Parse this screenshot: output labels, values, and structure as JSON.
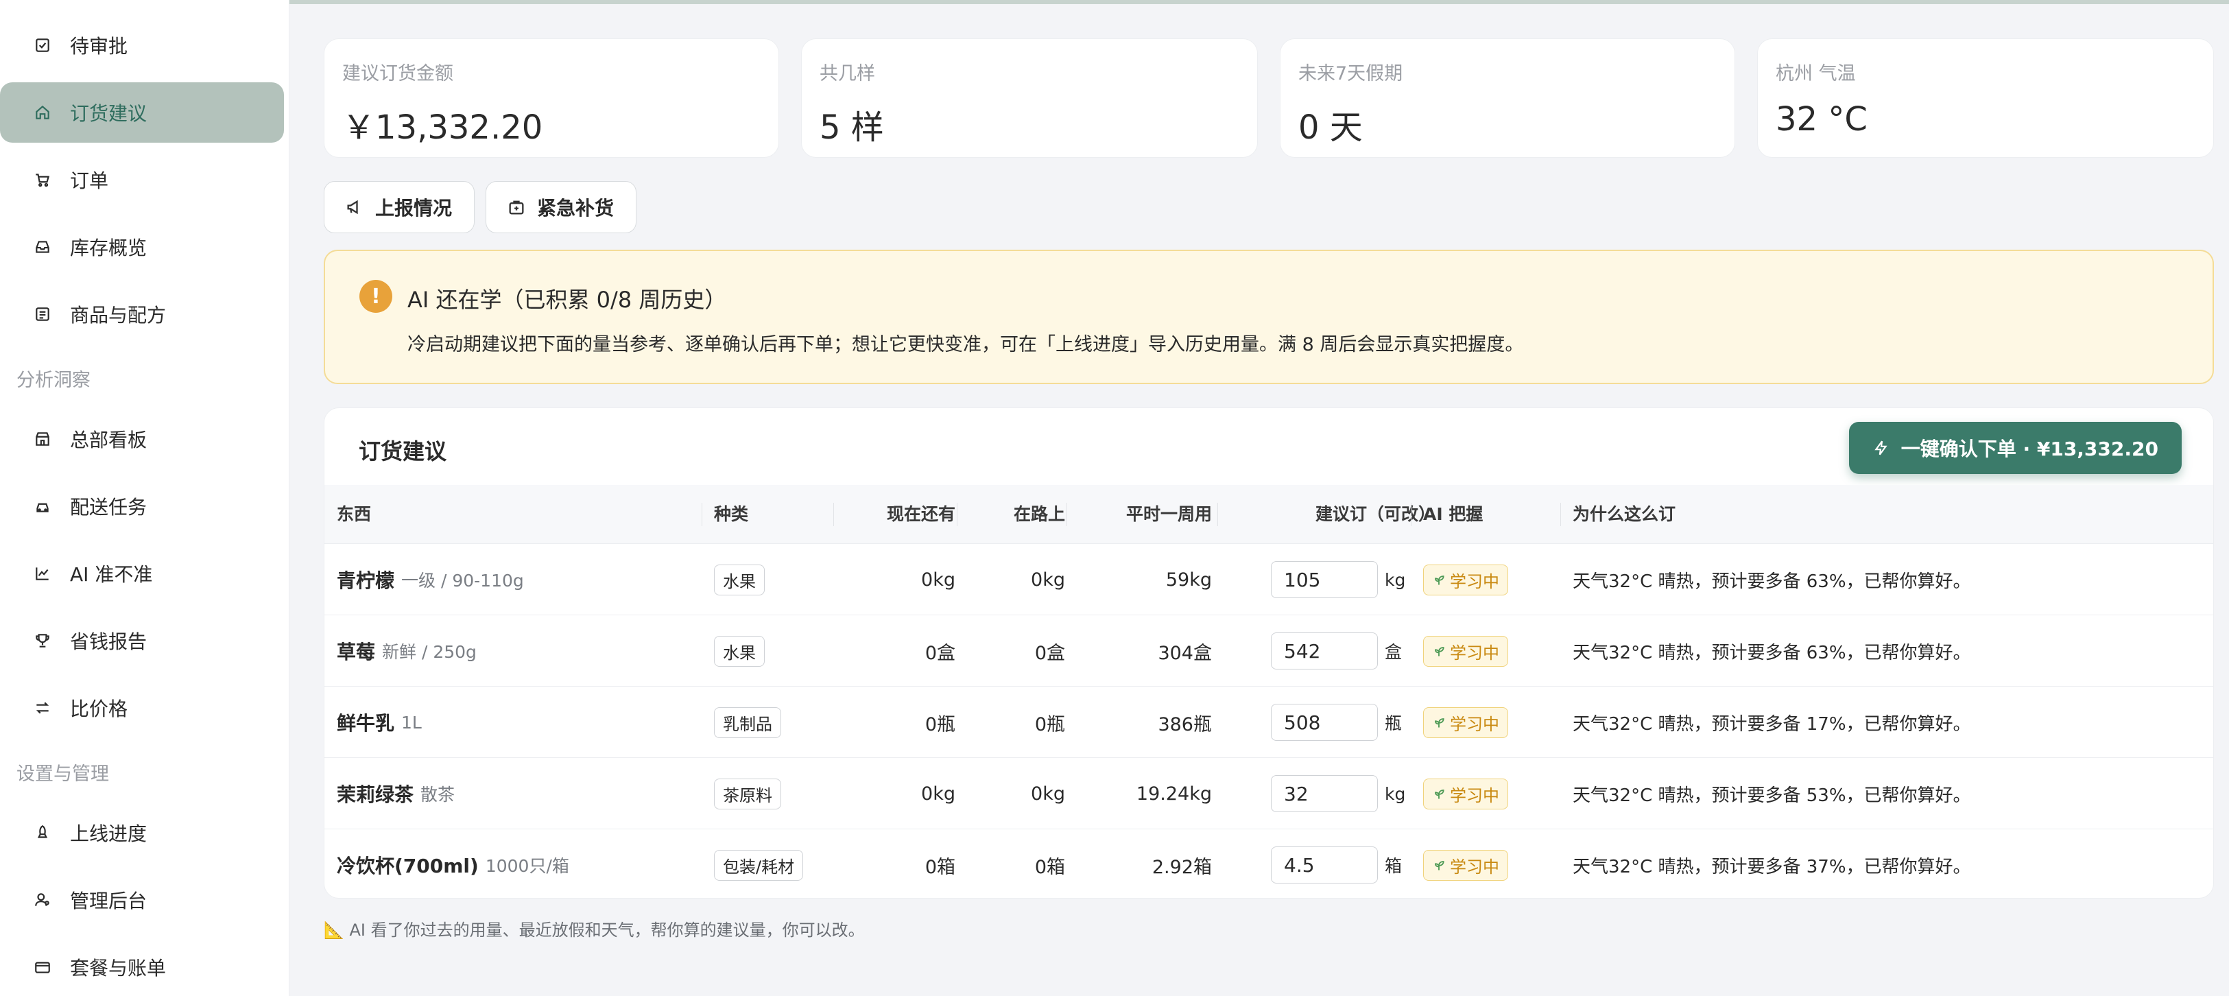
{
  "sidebar": {
    "items": [
      {
        "label": "待审批",
        "icon": "checkbox-icon"
      },
      {
        "label": "订货建议",
        "icon": "home-icon"
      },
      {
        "label": "订单",
        "icon": "cart-icon"
      },
      {
        "label": "库存概览",
        "icon": "inbox-icon"
      },
      {
        "label": "商品与配方",
        "icon": "list-icon"
      }
    ],
    "section_analysis": "分析洞察",
    "analysis_items": [
      {
        "label": "总部看板",
        "icon": "store-icon"
      },
      {
        "label": "配送任务",
        "icon": "car-icon"
      },
      {
        "label": "AI 准不准",
        "icon": "line-chart-icon"
      },
      {
        "label": "省钱报告",
        "icon": "trophy-icon"
      },
      {
        "label": "比价格",
        "icon": "compare-icon"
      }
    ],
    "section_settings": "设置与管理",
    "settings_items": [
      {
        "label": "上线进度",
        "icon": "rocket-icon"
      },
      {
        "label": "管理后台",
        "icon": "user-gear-icon"
      },
      {
        "label": "套餐与账单",
        "icon": "card-icon"
      }
    ]
  },
  "stats": [
    {
      "label": "建议订货金额",
      "value": "￥13,332.20"
    },
    {
      "label": "共几样",
      "value": "5 样"
    },
    {
      "label": "未来7天假期",
      "value": "0 天"
    },
    {
      "label": "杭州 气温",
      "value": "32 °C"
    }
  ],
  "actions": {
    "report_label": "上报情况",
    "urgent_label": "紧急补货"
  },
  "alert": {
    "badge": "!",
    "title": "AI 还在学（已积累 0/8 周历史）",
    "desc": "冷启动期建议把下面的量当参考、逐单确认后再下单；想让它更快变准，可在「上线进度」导入历史用量。满 8 周后会显示真实把握度。"
  },
  "table": {
    "title": "订货建议",
    "confirm_label": "一键确认下单 · ¥13,332.20",
    "headers": [
      "东西",
      "种类",
      "现在还有",
      "在路上",
      "平时一周用",
      "建议订（可改）",
      "AI 把握",
      "为什么这么订"
    ],
    "rows": [
      {
        "name": "青柠檬",
        "spec": "一级 / 90-110g",
        "category": "水果",
        "stock": "0kg",
        "transit": "0kg",
        "weekly": "59kg",
        "qty": "105",
        "unit": "kg",
        "confidence": "学习中",
        "reason": "天气32°C 晴热，预计要多备 63%，已帮你算好。"
      },
      {
        "name": "草莓",
        "spec": "新鲜 / 250g",
        "category": "水果",
        "stock": "0盒",
        "transit": "0盒",
        "weekly": "304盒",
        "qty": "542",
        "unit": "盒",
        "confidence": "学习中",
        "reason": "天气32°C 晴热，预计要多备 63%，已帮你算好。"
      },
      {
        "name": "鲜牛乳",
        "spec": "1L",
        "category": "乳制品",
        "stock": "0瓶",
        "transit": "0瓶",
        "weekly": "386瓶",
        "qty": "508",
        "unit": "瓶",
        "confidence": "学习中",
        "reason": "天气32°C 晴热，预计要多备 17%，已帮你算好。"
      },
      {
        "name": "茉莉绿茶",
        "spec": "散茶",
        "category": "茶原料",
        "stock": "0kg",
        "transit": "0kg",
        "weekly": "19.24kg",
        "qty": "32",
        "unit": "kg",
        "confidence": "学习中",
        "reason": "天气32°C 晴热，预计要多备 53%，已帮你算好。"
      },
      {
        "name": "冷饮杯(700ml)",
        "spec": "1000只/箱",
        "category": "包装/耗材",
        "stock": "0箱",
        "transit": "0箱",
        "weekly": "2.92箱",
        "qty": "4.5",
        "unit": "箱",
        "confidence": "学习中",
        "reason": "天气32°C 晴热，预计要多备 37%，已帮你算好。"
      }
    ]
  },
  "footnote": "📐 AI 看了你过去的用量、最近放假和天气，帮你算的建议量，你可以改。"
}
